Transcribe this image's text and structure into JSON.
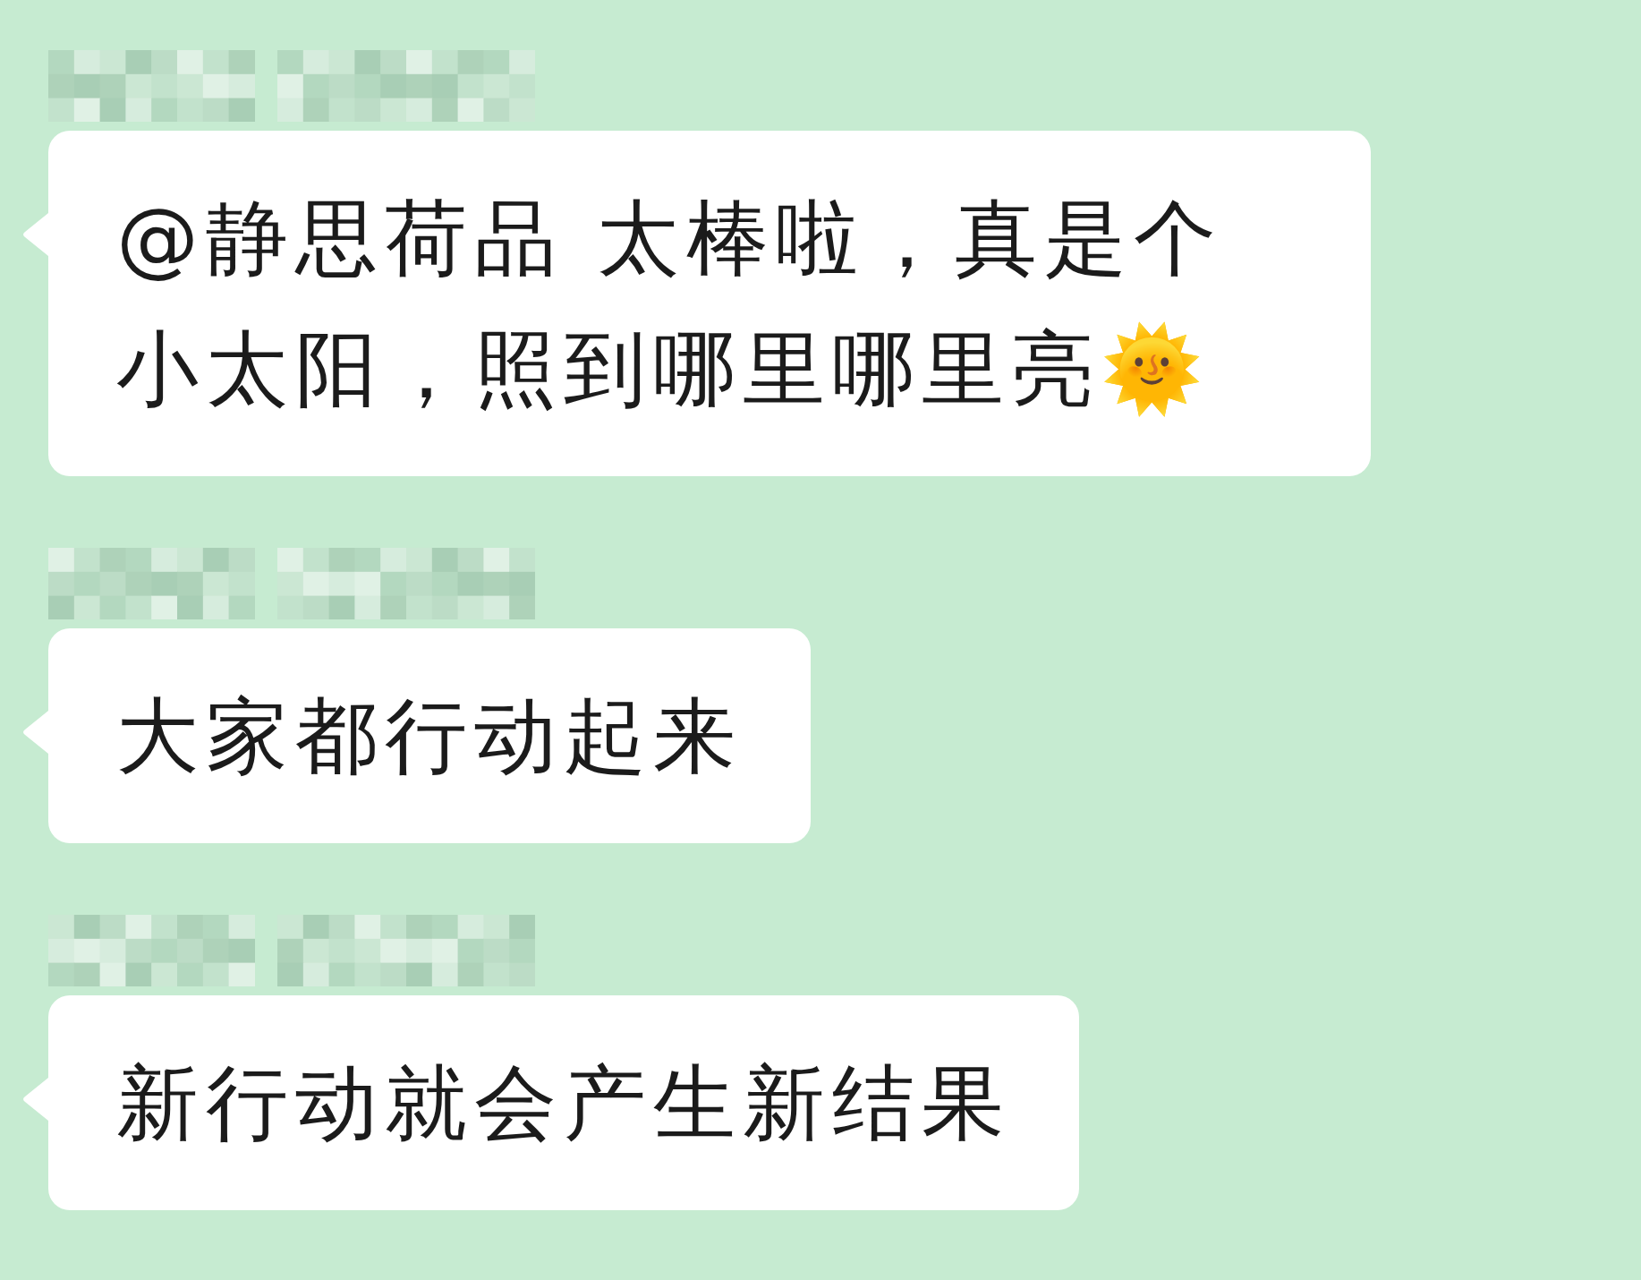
{
  "messages": [
    {
      "text": "@静思荷品 太棒啦，真是个小太阳，照到哪里哪里亮🌞"
    },
    {
      "text": "大家都行动起来"
    },
    {
      "text": "新行动就会产生新结果"
    }
  ]
}
